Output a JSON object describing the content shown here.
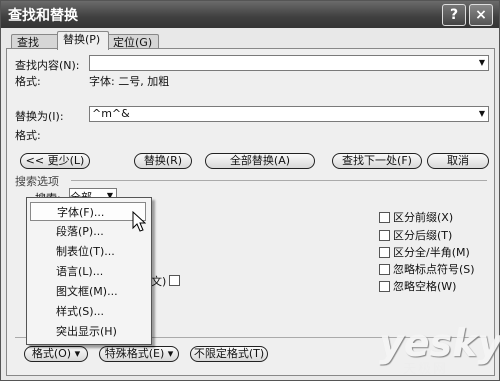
{
  "window": {
    "title": "查找和替换",
    "help": "?",
    "close": "×"
  },
  "tabs": [
    "查找(D)",
    "替换(P)",
    "定位(G)"
  ],
  "find": {
    "label": "查找内容(N):",
    "value": "",
    "format_label": "格式:",
    "format_value": "字体: 二号, 加粗"
  },
  "replace": {
    "label": "替换为(I):",
    "value": "^m^&",
    "format_label": "格式:"
  },
  "buttons": {
    "less": "<< 更少(L)",
    "replace": "替换(R)",
    "replace_all": "全部替换(A)",
    "find_next": "查找下一处(F)",
    "cancel": "取消"
  },
  "search_options": {
    "header": "搜索选项",
    "search_label": "搜索:",
    "search_value": "全部",
    "partial": "文)"
  },
  "right_options": [
    "区分前缀(X)",
    "区分后缀(T)",
    "区分全/半角(M)",
    "忽略标点符号(S)",
    "忽略空格(W)"
  ],
  "menu": [
    "字体(F)...",
    "段落(P)...",
    "制表位(T)...",
    "语言(L)...",
    "图文框(M)...",
    "样式(S)...",
    "突出显示(H)"
  ],
  "bottom": {
    "format": "格式(O) ▾",
    "special": "特殊格式(E) ▾",
    "no_format": "不限定格式(T)"
  },
  "watermark": {
    "main": "yesky",
    "sub": "天极网"
  }
}
